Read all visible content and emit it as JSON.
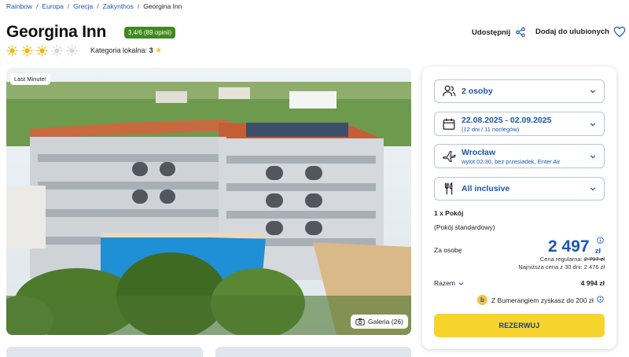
{
  "breadcrumb": [
    "Rainbow",
    "Europa",
    "Grecja",
    "Zakynthos",
    "Georgina Inn"
  ],
  "hotel": {
    "name": "Georgina Inn",
    "rating_badge": "3,4/6 (89 opinii)",
    "sun_rating": 3,
    "sun_max": 5,
    "local_category_label": "Kategoria lokalna:",
    "local_category_value": "3"
  },
  "actions": {
    "share_label": "Udostępnij",
    "favorite_label": "Dodaj do ulubionych"
  },
  "gallery": {
    "badge": "Last Minute!",
    "button_label": "Galeria (26)"
  },
  "booking": {
    "guests": "2 osoby",
    "dates": "22.08.2025 - 02.09.2025",
    "dates_sub": "(12 dni / 11 noclegów)",
    "flight": "Wrocław",
    "flight_sub": "wylot 02:30, bez przesiadek, Enter Air",
    "board": "All inclusive",
    "room_qty": "1 x Pokój",
    "room_type": "(Pokój standardowy)",
    "per_person_label": "Za osobę",
    "price": "2 497",
    "currency": "zł",
    "regular_label": "Cena regularna:",
    "regular_price": "2 797 zł",
    "lowest_label": "Najniższa cena z 30 dni:",
    "lowest_price": "2 476 zł",
    "total_label": "Razem",
    "total_value": "4 994 zł",
    "bumerang_text": "Z Bumerangiem zyskasz do 200 zł",
    "reserve_label": "REZERWUJ"
  },
  "colors": {
    "accent": "#1a56b0",
    "rating_green": "#3e8a1f",
    "reserve_yellow": "#f7d42c",
    "sun_active": "#f5b400",
    "sun_inactive": "#d7d7d7"
  }
}
